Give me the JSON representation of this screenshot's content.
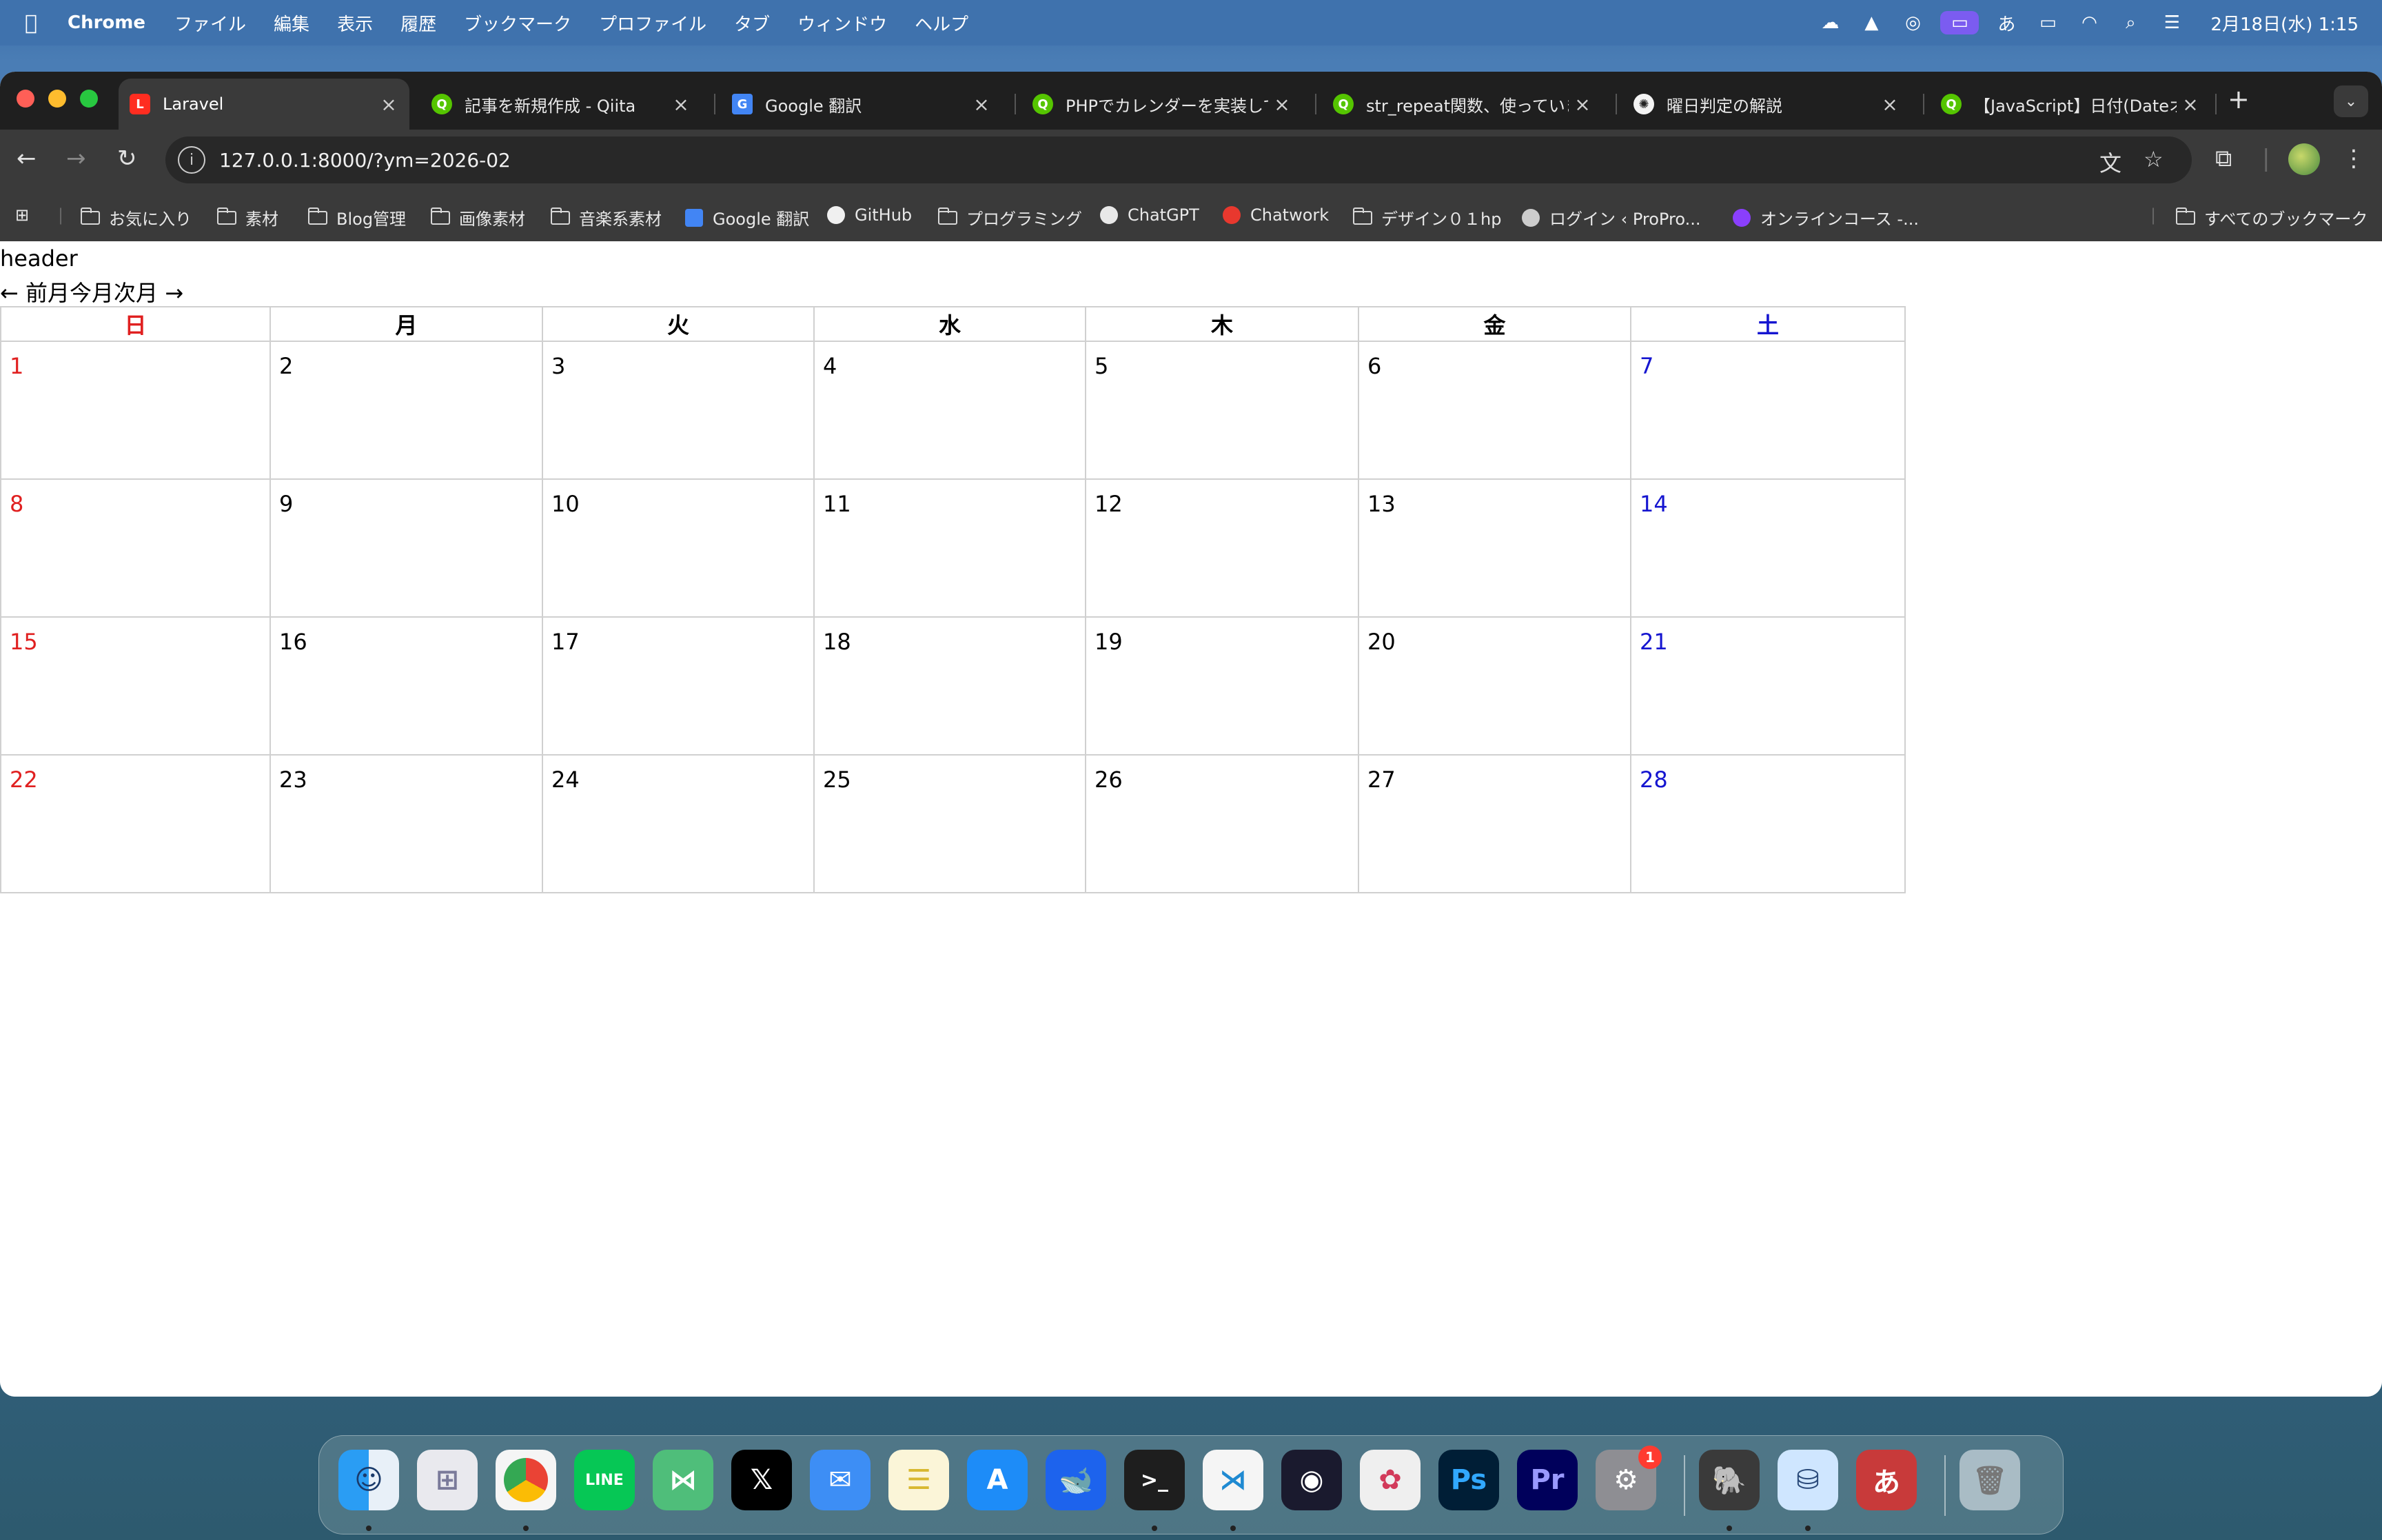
{
  "menubar": {
    "app_name": "Chrome",
    "items": [
      "ファイル",
      "編集",
      "表示",
      "履歴",
      "ブックマーク",
      "プロファイル",
      "タブ",
      "ウィンドウ",
      "ヘルプ"
    ],
    "clock": "2月18日(水) 1:15",
    "ime_indicator": "あ"
  },
  "tabs": [
    {
      "title": "Laravel",
      "active": true
    },
    {
      "title": "記事を新規作成 - Qiita"
    },
    {
      "title": "Google 翻訳"
    },
    {
      "title": "PHPでカレンダーを実装して"
    },
    {
      "title": "str_repeat関数、使っていま"
    },
    {
      "title": "曜日判定の解説"
    },
    {
      "title": "【JavaScript】日付(Dateオ"
    }
  ],
  "address_bar": {
    "url": "127.0.0.1:8000/?ym=2026-02"
  },
  "bookmarks": [
    "お気に入り",
    "素材",
    "Blog管理",
    "画像素材",
    "音楽系素材",
    "Google 翻訳",
    "GitHub",
    "プログラミング",
    "ChatGPT",
    "Chatwork",
    "デザイン０１hp",
    "ログイン ‹ ProPro...",
    "オンラインコース -..."
  ],
  "all_bookmarks": "すべてのブックマーク",
  "page": {
    "header": "header",
    "nav": {
      "prev": "← 前月",
      "current": "今月",
      "next": "次月 →"
    },
    "weekdays": [
      "日",
      "月",
      "火",
      "水",
      "木",
      "金",
      "土"
    ],
    "weeks": [
      [
        "1",
        "2",
        "3",
        "4",
        "5",
        "6",
        "7"
      ],
      [
        "8",
        "9",
        "10",
        "11",
        "12",
        "13",
        "14"
      ],
      [
        "15",
        "16",
        "17",
        "18",
        "19",
        "20",
        "21"
      ],
      [
        "22",
        "23",
        "24",
        "25",
        "26",
        "27",
        "28"
      ]
    ],
    "colors": {
      "sunday": "#e02020",
      "saturday": "#1515d0"
    }
  },
  "dock": {
    "apps": [
      "Finder",
      "Launchpad",
      "Google Chrome",
      "LINE",
      "Mailspring",
      "X",
      "Mail",
      "Notes",
      "App Store",
      "Docker",
      "Terminal",
      "Visual Studio Code",
      "OBS",
      "DaVinci Resolve",
      "Photoshop",
      "Premiere Pro",
      "System Settings",
      "TablePlus",
      "Sequel Ace",
      "Dictionary",
      "Trash"
    ],
    "settings_badge": "1"
  }
}
